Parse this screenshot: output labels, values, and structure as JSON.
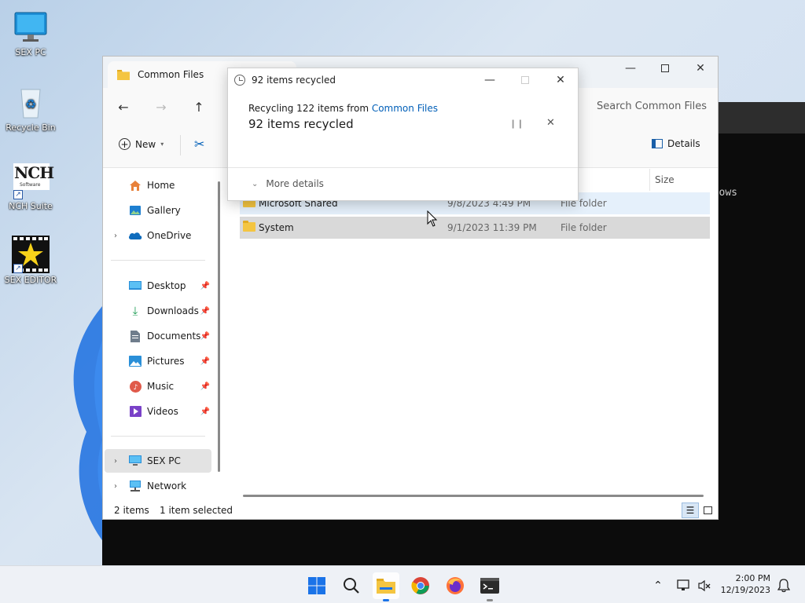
{
  "desktop": {
    "icons": [
      {
        "label": "SEX PC",
        "icon": "monitor-icon"
      },
      {
        "label": "Recycle Bin",
        "icon": "recycle-bin-icon"
      },
      {
        "label": "NCH Suite",
        "icon": "nch-suite-icon",
        "logo_text": "NCH",
        "logo_sub": "Software"
      },
      {
        "label": "SEX EDITOR",
        "icon": "star-clapper-icon"
      }
    ]
  },
  "terminal": {
    "visible_text": "ows"
  },
  "explorer": {
    "tab_title": "Common Files",
    "search_placeholder": "Search Common Files",
    "toolbar": {
      "new_label": "New",
      "details_label": "Details"
    },
    "sidebar": {
      "home": "Home",
      "gallery": "Gallery",
      "onedrive": "OneDrive",
      "desktop": "Desktop",
      "downloads": "Downloads",
      "documents": "Documents",
      "pictures": "Pictures",
      "music": "Music",
      "videos": "Videos",
      "this_pc": "SEX PC",
      "network": "Network"
    },
    "columns": {
      "size": "Size"
    },
    "files": [
      {
        "name": "Microsoft Shared",
        "date": "9/8/2023 4:49 PM",
        "type": "File folder"
      },
      {
        "name": "System",
        "date": "9/1/2023 11:39 PM",
        "type": "File folder"
      }
    ],
    "status": {
      "count": "2 items",
      "selection": "1 item selected"
    }
  },
  "dialog": {
    "title": "92 items recycled",
    "line1_prefix": "Recycling 122 items from ",
    "line1_link": "Common Files",
    "line2": "92 items recycled",
    "more_details": "More details"
  },
  "taskbar": {
    "time": "2:00 PM",
    "date": "12/19/2023"
  },
  "colors": {
    "accent": "#005fb8",
    "folder": "#f4c541",
    "selected_row": "#d9d9d9",
    "hover_row": "#e5f0fb"
  }
}
